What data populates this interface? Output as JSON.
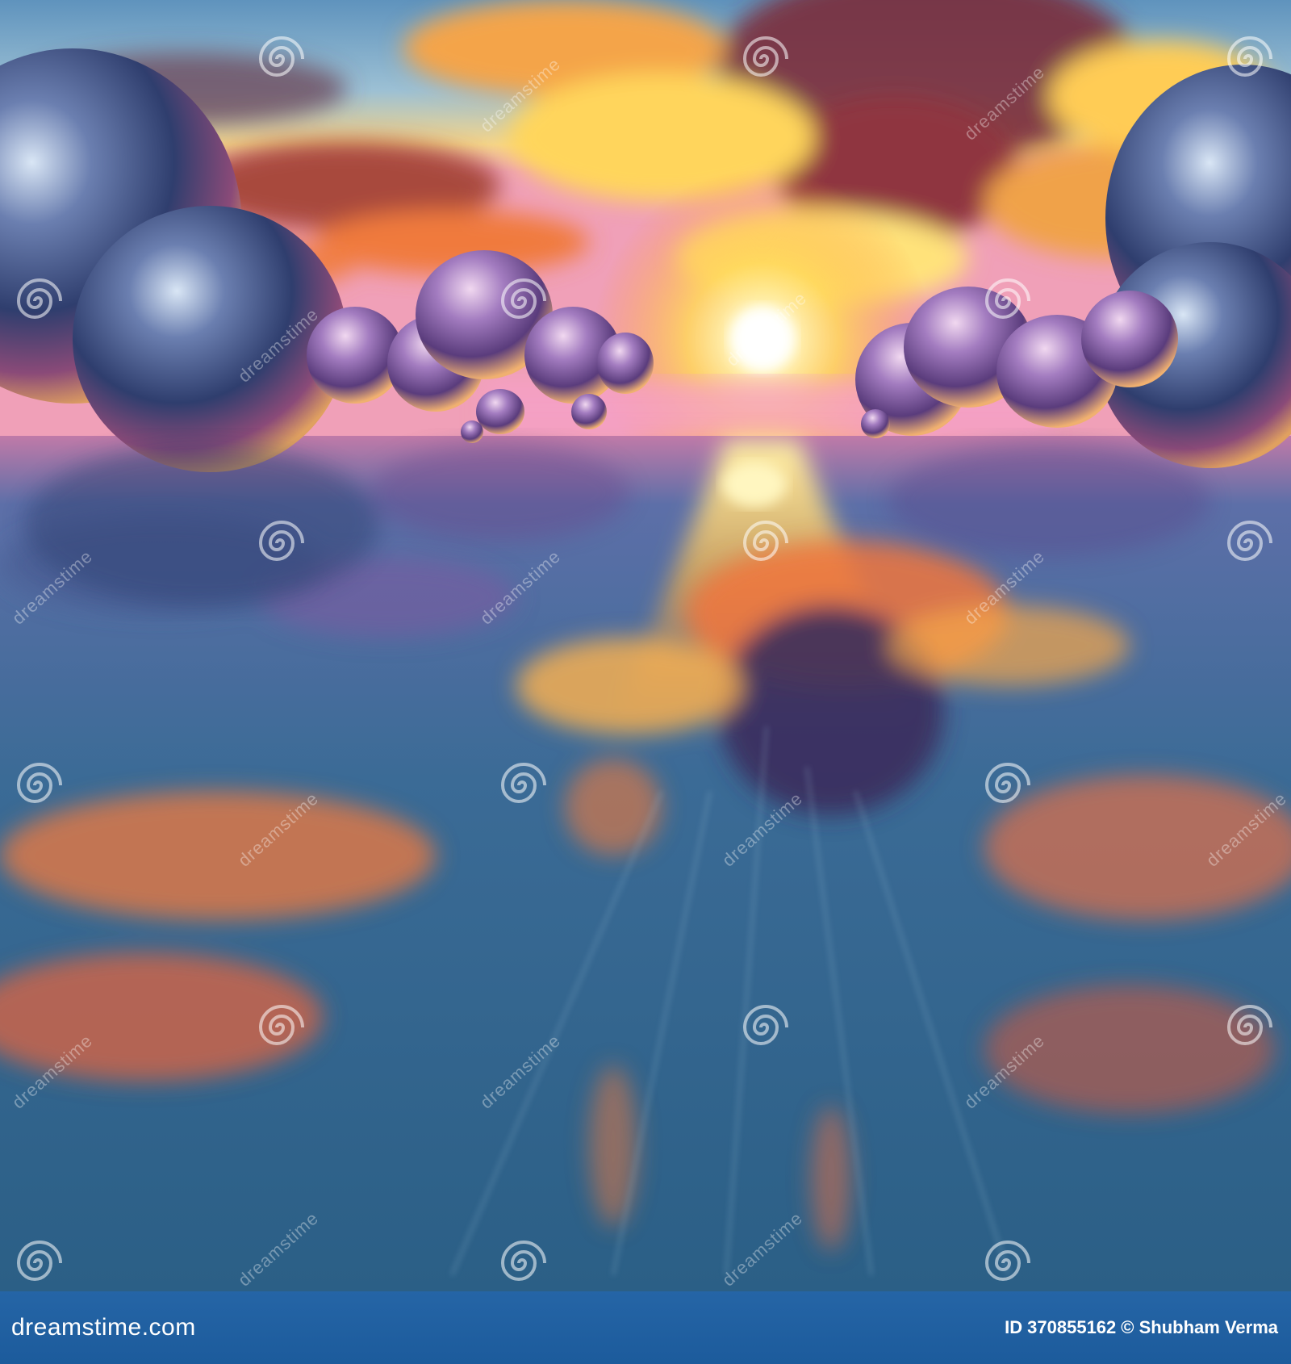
{
  "image": {
    "subject": "sunset",
    "watermark_text": "dreamstime",
    "colors": {
      "sky_blue": "#6fa6c8",
      "sun": "#fff6c0",
      "cloud_orange": "#f07a3c",
      "cloud_dark": "#7a2c3a",
      "water": "#2e5f8c",
      "footer_blue": "#2565a6"
    }
  },
  "footer": {
    "logo": "dreamstime.com",
    "id_label": "ID",
    "id_number": "370855162",
    "credit": "© Shubham Verma"
  }
}
